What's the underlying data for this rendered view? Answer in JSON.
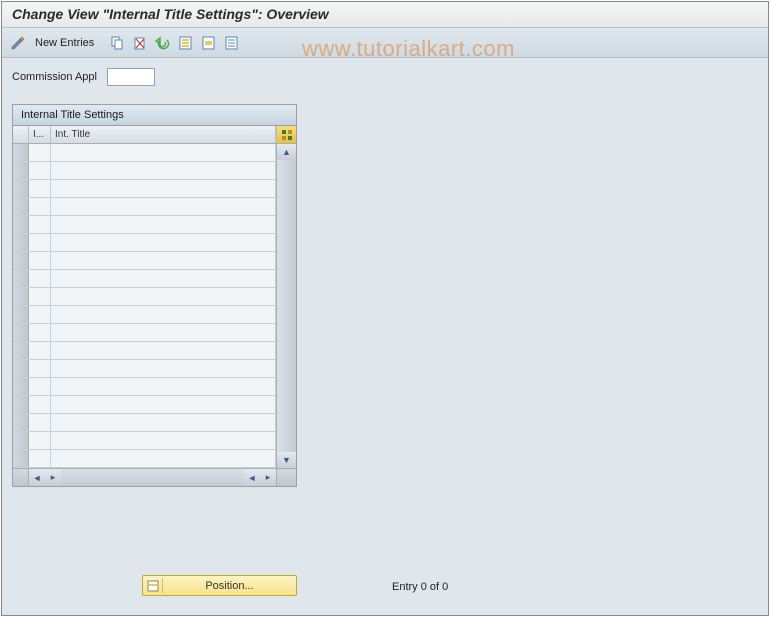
{
  "title": "Change View \"Internal Title Settings\": Overview",
  "toolbar": {
    "new_entries_label": "New Entries"
  },
  "field": {
    "commission_appl_label": "Commission Appl",
    "commission_appl_value": ""
  },
  "table": {
    "title": "Internal Title Settings",
    "col1_header": "I...",
    "col2_header": "Int. Title",
    "row_count": 18
  },
  "footer": {
    "position_label": "Position...",
    "entry_status": "Entry 0 of 0"
  },
  "watermark": "www.tutorialkart.com"
}
